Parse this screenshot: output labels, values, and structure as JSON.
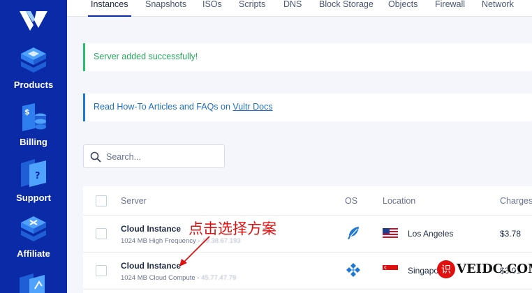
{
  "sidebar": {
    "items": [
      {
        "label": "Products",
        "icon": "products-icon"
      },
      {
        "label": "Billing",
        "icon": "billing-icon"
      },
      {
        "label": "Support",
        "icon": "support-icon"
      },
      {
        "label": "Affiliate",
        "icon": "affiliate-icon"
      }
    ]
  },
  "tabs": [
    "Instances",
    "Snapshots",
    "ISOs",
    "Scripts",
    "DNS",
    "Block Storage",
    "Objects",
    "Firewall",
    "Network"
  ],
  "active_tab": "Instances",
  "notices": {
    "success": "Server added successfully!",
    "info_prefix": "Read How-To Articles and FAQs on ",
    "info_link": "Vultr Docs"
  },
  "search": {
    "placeholder": "Search...",
    "value": ""
  },
  "table": {
    "headers": {
      "server": "Server",
      "os": "OS",
      "location": "Location",
      "charges": "Charges"
    },
    "rows": [
      {
        "name": "Cloud Instance",
        "plan": "1024 MB High Frequency",
        "ip": "49.38.67.193",
        "os_icon": "feather-icon",
        "flag": "us-flag-icon",
        "location": "Los Angeles",
        "charges": "$3.78"
      },
      {
        "name": "Cloud Instance",
        "plan": "1024 MB Cloud Compute",
        "ip": "45.77.47.79",
        "os_icon": "diamond-grid-icon",
        "flag": "sg-flag-icon",
        "location": "Singapore",
        "charges": "$3.01"
      }
    ]
  },
  "annotation": "点击选择方案",
  "watermark": {
    "symbol": "识",
    "text": "VEIDC.COM"
  },
  "colors": {
    "sidebar": "#0b2aa8",
    "success": "#27c06b",
    "info": "#1f78d1",
    "annotation": "#e01010"
  }
}
